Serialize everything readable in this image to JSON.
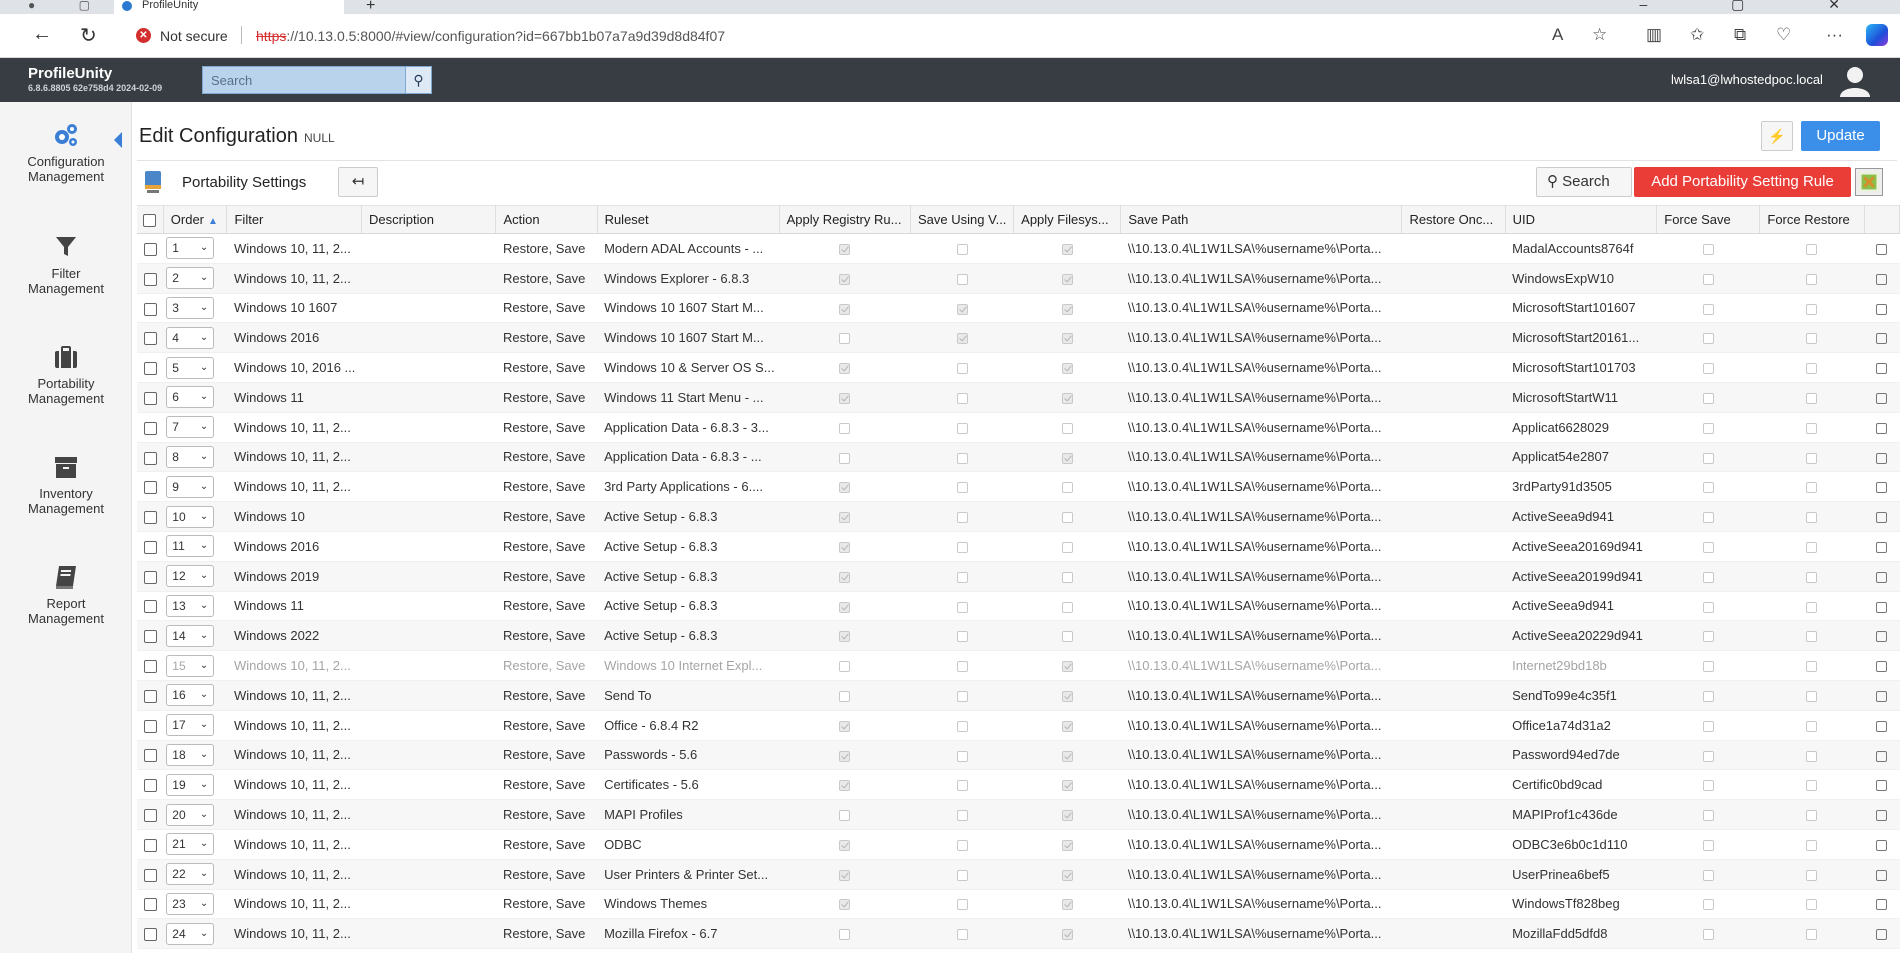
{
  "browser": {
    "tab_title": "ProfileUnity",
    "security_label": "Not secure",
    "url_scheme": "https",
    "url_rest": "://10.13.0.5:8000/#view/configuration?id=667bb1b07a7a9d39d8d84f07"
  },
  "header": {
    "brand": "ProfileUnity",
    "version": "6.8.6.8805 62e758d4 2024-02-09",
    "search_placeholder": "Search",
    "user": "lwlsa1@lwhostedpoc.local"
  },
  "sidebar": {
    "items": [
      {
        "label1": "Configuration",
        "label2": "Management",
        "icon": "gears-icon"
      },
      {
        "label1": "Filter",
        "label2": "Management",
        "icon": "filter-icon"
      },
      {
        "label1": "Portability",
        "label2": "Management",
        "icon": "briefcase-icon"
      },
      {
        "label1": "Inventory",
        "label2": "Management",
        "icon": "archive-icon"
      },
      {
        "label1": "Report",
        "label2": "Management",
        "icon": "book-icon"
      }
    ]
  },
  "page": {
    "title": "Edit Configuration",
    "title_suffix": "NULL",
    "update_label": "Update",
    "section_title": "Portability Settings",
    "search_label": "Search",
    "add_rule_label": "Add Portability Setting Rule"
  },
  "table": {
    "columns": [
      "Order",
      "Filter",
      "Description",
      "Action",
      "Ruleset",
      "Apply Registry Ru...",
      "Save Using V...",
      "Apply Filesys...",
      "Save Path",
      "Restore Onc...",
      "UID",
      "Force Save",
      "Force Restore"
    ],
    "rows": [
      {
        "order": "1",
        "filter": "Windows 10, 11, 2...",
        "desc": "",
        "action": "Restore, Save",
        "ruleset": "Modern ADAL Accounts - ...",
        "reg": true,
        "vhd": false,
        "fs": true,
        "path": "\\\\10.13.0.4\\L1W1LSA\\%username%\\Porta...",
        "uid": "MadalAccounts8764f",
        "dim": false
      },
      {
        "order": "2",
        "filter": "Windows 10, 11, 2...",
        "desc": "",
        "action": "Restore, Save",
        "ruleset": "Windows Explorer - 6.8.3",
        "reg": true,
        "vhd": false,
        "fs": true,
        "path": "\\\\10.13.0.4\\L1W1LSA\\%username%\\Porta...",
        "uid": "WindowsExpW10",
        "dim": false
      },
      {
        "order": "3",
        "filter": "Windows 10 1607",
        "desc": "",
        "action": "Restore, Save",
        "ruleset": "Windows 10 1607 Start M...",
        "reg": true,
        "vhd": true,
        "fs": true,
        "path": "\\\\10.13.0.4\\L1W1LSA\\%username%\\Porta...",
        "uid": "MicrosoftStart101607",
        "dim": false
      },
      {
        "order": "4",
        "filter": "Windows 2016",
        "desc": "",
        "action": "Restore, Save",
        "ruleset": "Windows 10 1607 Start M...",
        "reg": false,
        "vhd": true,
        "fs": true,
        "path": "\\\\10.13.0.4\\L1W1LSA\\%username%\\Porta...",
        "uid": "MicrosoftStart20161...",
        "dim": false
      },
      {
        "order": "5",
        "filter": "Windows 10, 2016 ...",
        "desc": "",
        "action": "Restore, Save",
        "ruleset": "Windows 10 & Server OS S...",
        "reg": true,
        "vhd": false,
        "fs": true,
        "path": "\\\\10.13.0.4\\L1W1LSA\\%username%\\Porta...",
        "uid": "MicrosoftStart101703",
        "dim": false
      },
      {
        "order": "6",
        "filter": "Windows 11",
        "desc": "",
        "action": "Restore, Save",
        "ruleset": "Windows 11 Start Menu - ...",
        "reg": true,
        "vhd": false,
        "fs": true,
        "path": "\\\\10.13.0.4\\L1W1LSA\\%username%\\Porta...",
        "uid": "MicrosoftStartW11",
        "dim": false
      },
      {
        "order": "7",
        "filter": "Windows 10, 11, 2...",
        "desc": "",
        "action": "Restore, Save",
        "ruleset": "Application Data - 6.8.3 - 3...",
        "reg": false,
        "vhd": false,
        "fs": false,
        "path": "\\\\10.13.0.4\\L1W1LSA\\%username%\\Porta...",
        "uid": "Applicat6628029",
        "dim": false
      },
      {
        "order": "8",
        "filter": "Windows 10, 11, 2...",
        "desc": "",
        "action": "Restore, Save",
        "ruleset": "Application Data - 6.8.3 - ...",
        "reg": false,
        "vhd": false,
        "fs": true,
        "path": "\\\\10.13.0.4\\L1W1LSA\\%username%\\Porta...",
        "uid": "Applicat54e2807",
        "dim": false
      },
      {
        "order": "9",
        "filter": "Windows 10, 11, 2...",
        "desc": "",
        "action": "Restore, Save",
        "ruleset": "3rd Party Applications - 6....",
        "reg": true,
        "vhd": false,
        "fs": false,
        "path": "\\\\10.13.0.4\\L1W1LSA\\%username%\\Porta...",
        "uid": "3rdParty91d3505",
        "dim": false
      },
      {
        "order": "10",
        "filter": "Windows 10",
        "desc": "",
        "action": "Restore, Save",
        "ruleset": "Active Setup - 6.8.3",
        "reg": true,
        "vhd": false,
        "fs": false,
        "path": "\\\\10.13.0.4\\L1W1LSA\\%username%\\Porta...",
        "uid": "ActiveSeea9d941",
        "dim": false
      },
      {
        "order": "11",
        "filter": "Windows 2016",
        "desc": "",
        "action": "Restore, Save",
        "ruleset": "Active Setup - 6.8.3",
        "reg": true,
        "vhd": false,
        "fs": false,
        "path": "\\\\10.13.0.4\\L1W1LSA\\%username%\\Porta...",
        "uid": "ActiveSeea20169d941",
        "dim": false
      },
      {
        "order": "12",
        "filter": "Windows 2019",
        "desc": "",
        "action": "Restore, Save",
        "ruleset": "Active Setup - 6.8.3",
        "reg": true,
        "vhd": false,
        "fs": false,
        "path": "\\\\10.13.0.4\\L1W1LSA\\%username%\\Porta...",
        "uid": "ActiveSeea20199d941",
        "dim": false
      },
      {
        "order": "13",
        "filter": "Windows 11",
        "desc": "",
        "action": "Restore, Save",
        "ruleset": "Active Setup - 6.8.3",
        "reg": true,
        "vhd": false,
        "fs": false,
        "path": "\\\\10.13.0.4\\L1W1LSA\\%username%\\Porta...",
        "uid": "ActiveSeea9d941",
        "dim": false
      },
      {
        "order": "14",
        "filter": "Windows 2022",
        "desc": "",
        "action": "Restore, Save",
        "ruleset": "Active Setup - 6.8.3",
        "reg": true,
        "vhd": false,
        "fs": false,
        "path": "\\\\10.13.0.4\\L1W1LSA\\%username%\\Porta...",
        "uid": "ActiveSeea20229d941",
        "dim": false
      },
      {
        "order": "15",
        "filter": "Windows 10, 11, 2...",
        "desc": "",
        "action": "Restore, Save",
        "ruleset": "Windows 10 Internet Expl...",
        "reg": false,
        "vhd": false,
        "fs": true,
        "path": "\\\\10.13.0.4\\L1W1LSA\\%username%\\Porta...",
        "uid": "Internet29bd18b",
        "dim": true
      },
      {
        "order": "16",
        "filter": "Windows 10, 11, 2...",
        "desc": "",
        "action": "Restore, Save",
        "ruleset": "Send To",
        "reg": false,
        "vhd": false,
        "fs": true,
        "path": "\\\\10.13.0.4\\L1W1LSA\\%username%\\Porta...",
        "uid": "SendTo99e4c35f1",
        "dim": false
      },
      {
        "order": "17",
        "filter": "Windows 10, 11, 2...",
        "desc": "",
        "action": "Restore, Save",
        "ruleset": "Office - 6.8.4 R2",
        "reg": true,
        "vhd": false,
        "fs": true,
        "path": "\\\\10.13.0.4\\L1W1LSA\\%username%\\Porta...",
        "uid": "Office1a74d31a2",
        "dim": false
      },
      {
        "order": "18",
        "filter": "Windows 10, 11, 2...",
        "desc": "",
        "action": "Restore, Save",
        "ruleset": "Passwords - 5.6",
        "reg": true,
        "vhd": false,
        "fs": true,
        "path": "\\\\10.13.0.4\\L1W1LSA\\%username%\\Porta...",
        "uid": "Password94ed7de",
        "dim": false
      },
      {
        "order": "19",
        "filter": "Windows 10, 11, 2...",
        "desc": "",
        "action": "Restore, Save",
        "ruleset": "Certificates - 5.6",
        "reg": true,
        "vhd": false,
        "fs": true,
        "path": "\\\\10.13.0.4\\L1W1LSA\\%username%\\Porta...",
        "uid": "Certific0bd9cad",
        "dim": false
      },
      {
        "order": "20",
        "filter": "Windows 10, 11, 2...",
        "desc": "",
        "action": "Restore, Save",
        "ruleset": "MAPI Profiles",
        "reg": false,
        "vhd": false,
        "fs": true,
        "path": "\\\\10.13.0.4\\L1W1LSA\\%username%\\Porta...",
        "uid": "MAPIProf1c436de",
        "dim": false
      },
      {
        "order": "21",
        "filter": "Windows 10, 11, 2...",
        "desc": "",
        "action": "Restore, Save",
        "ruleset": "ODBC",
        "reg": true,
        "vhd": false,
        "fs": true,
        "path": "\\\\10.13.0.4\\L1W1LSA\\%username%\\Porta...",
        "uid": "ODBC3e6b0c1d110",
        "dim": false
      },
      {
        "order": "22",
        "filter": "Windows 10, 11, 2...",
        "desc": "",
        "action": "Restore, Save",
        "ruleset": "User Printers & Printer Set...",
        "reg": true,
        "vhd": false,
        "fs": true,
        "path": "\\\\10.13.0.4\\L1W1LSA\\%username%\\Porta...",
        "uid": "UserPrinea6bef5",
        "dim": false
      },
      {
        "order": "23",
        "filter": "Windows 10, 11, 2...",
        "desc": "",
        "action": "Restore, Save",
        "ruleset": "Windows Themes",
        "reg": true,
        "vhd": false,
        "fs": true,
        "path": "\\\\10.13.0.4\\L1W1LSA\\%username%\\Porta...",
        "uid": "WindowsTf828beg",
        "dim": false
      },
      {
        "order": "24",
        "filter": "Windows 10, 11, 2...",
        "desc": "",
        "action": "Restore, Save",
        "ruleset": "Mozilla Firefox - 6.7",
        "reg": false,
        "vhd": false,
        "fs": true,
        "path": "\\\\10.13.0.4\\L1W1LSA\\%username%\\Porta...",
        "uid": "MozillaFdd5dfd8",
        "dim": false
      }
    ]
  },
  "colors": {
    "header_bg": "#383d44",
    "update_button": "#3b8fe8",
    "add_button": "#ea3d37",
    "accent": "#3a7fd5"
  }
}
